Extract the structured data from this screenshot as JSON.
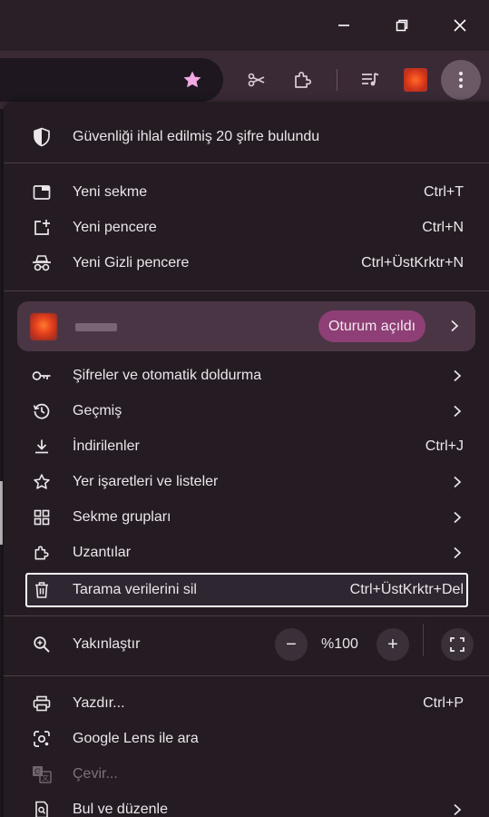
{
  "window": {
    "minimize_icon": "minimize-icon",
    "restore_icon": "restore-icon",
    "close_icon": "close-icon"
  },
  "toolbar": {
    "bookmark_icon": "star-icon",
    "icons": [
      "customize-chrome-icon",
      "extensions-puzzle-icon",
      "media-queue-icon",
      "profile-avatar",
      "more-menu-kebab-icon"
    ]
  },
  "menu": {
    "security_alert": "Güvenliği ihlal edilmiş 20 şifre bulundu",
    "new_tab": {
      "label": "Yeni sekme",
      "shortcut": "Ctrl+T"
    },
    "new_window": {
      "label": "Yeni pencere",
      "shortcut": "Ctrl+N"
    },
    "incognito": {
      "label": "Yeni Gizli pencere",
      "shortcut": "Ctrl+ÜstKrktr+N"
    },
    "profile": {
      "status": "Oturum açıldı"
    },
    "passwords": {
      "label": "Şifreler ve otomatik doldurma"
    },
    "history": {
      "label": "Geçmiş"
    },
    "downloads": {
      "label": "İndirilenler",
      "shortcut": "Ctrl+J"
    },
    "bookmarks": {
      "label": "Yer işaretleri ve listeler"
    },
    "tab_groups": {
      "label": "Sekme grupları"
    },
    "extensions": {
      "label": "Uzantılar"
    },
    "clear_data": {
      "label": "Tarama verilerini sil",
      "shortcut": "Ctrl+ÜstKrktr+Del"
    },
    "zoom": {
      "label": "Yakınlaştır",
      "value": "%100",
      "minus": "−",
      "plus": "+"
    },
    "print": {
      "label": "Yazdır...",
      "shortcut": "Ctrl+P"
    },
    "lens": {
      "label": "Google Lens ile ara"
    },
    "translate": {
      "label": "Çevir..."
    },
    "find_edit": {
      "label": "Bul ve düzenle"
    }
  },
  "colors": {
    "menu_bg": "#241c22",
    "accent_badge": "#8e3f75",
    "highlight_border": "#ffffff"
  }
}
